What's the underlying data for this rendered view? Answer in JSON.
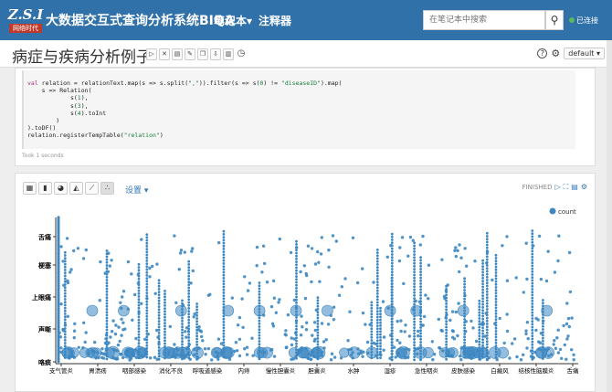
{
  "topnav": {
    "logo_line1": "Z.S.I",
    "logo_line2": "网络时代",
    "title": "大数据交互式查询分析系统BIQA",
    "notebook": "笔记本▾",
    "interpreter": "注释器",
    "search_placeholder": "在笔记本中搜索",
    "connected": "已连接",
    "accent": "#3071a9",
    "connected_color": "#5cb85c"
  },
  "notebar": {
    "title": "病症与疾病分析例子",
    "default_label": "default ▾"
  },
  "code": {
    "line1": "val relation = relationText.map(s => s.split(\",\")).filter(s => s(0) != \"diseaseID\").map(",
    "line2": "    s => Relation(",
    "line3": "            s(1),",
    "line4": "            s(3),",
    "line5": "            s(4).toInt",
    "line6": "        )",
    "line7": ").toDF()",
    "line8": "relation.registerTempTable(\"relation\")",
    "took": "Took 1 seconds"
  },
  "para2": {
    "settings": "设置 ▾",
    "status": "FINISHED"
  },
  "chart_data": {
    "type": "scatter",
    "legend": [
      "count"
    ],
    "legend_position": "top-right",
    "series_color": "#3d87c1",
    "y_categories": [
      "咯痰",
      "声嘶",
      "上眼痛",
      "梗塞",
      "舌痛"
    ],
    "x_categories": [
      "支气管炎",
      "胃溃疡",
      "咽部感染",
      "消化不良",
      "呼吸道感染",
      "内痔",
      "慢性胆囊炎",
      "胆囊炎",
      "水肿",
      "湿疹",
      "急性咽炎",
      "皮肤感染",
      "白癜风",
      "结核性脑膜炎",
      "舌痛"
    ]
  }
}
